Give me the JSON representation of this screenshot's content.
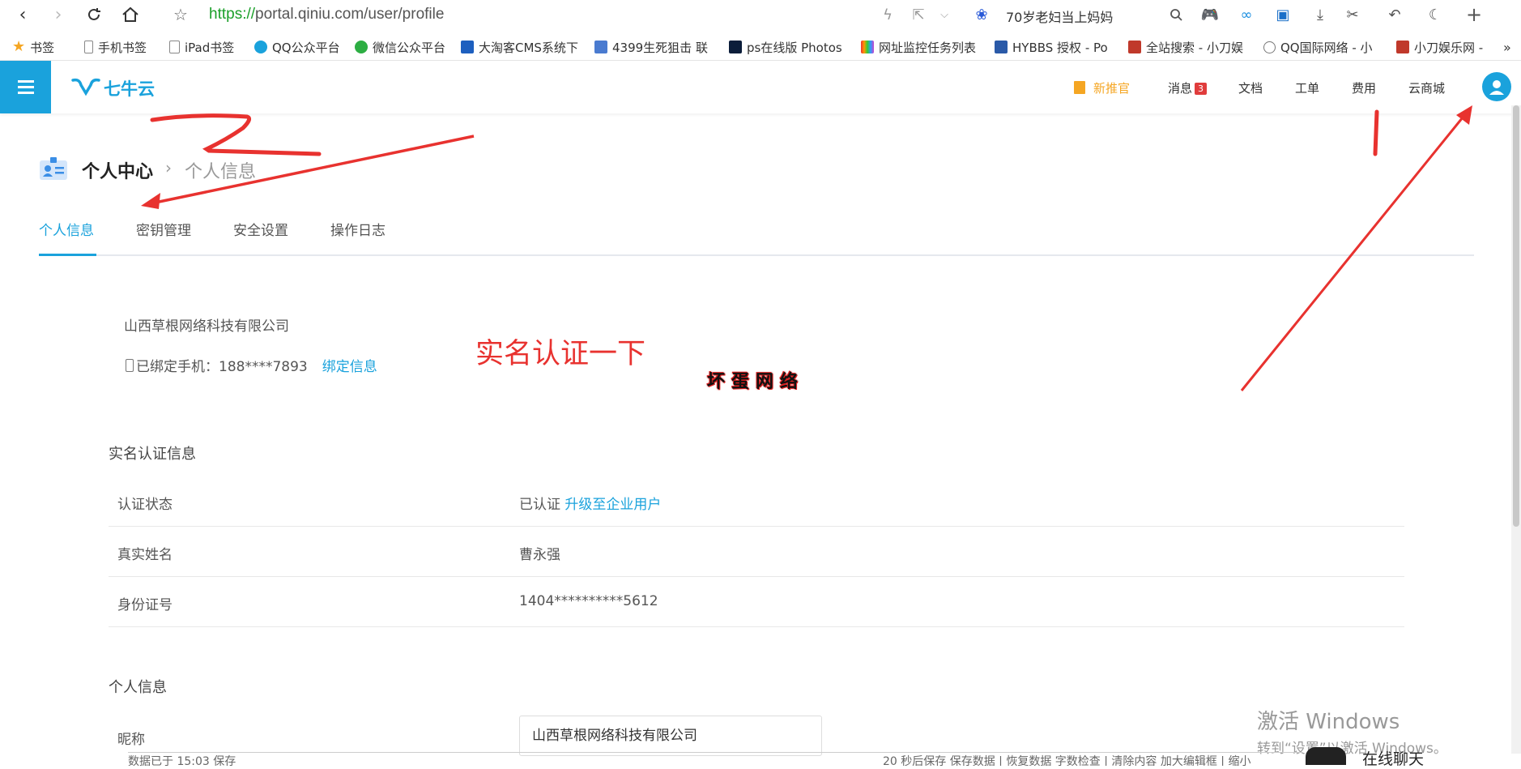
{
  "browser": {
    "url_protocol": "https://",
    "url_rest": "portal.qiniu.com/user/profile",
    "search_text": "70岁老妇当上妈妈",
    "bookmarks": [
      {
        "label": "书签",
        "icon": "star-icon",
        "color": "#f5a623"
      },
      {
        "label": "手机书签",
        "icon": "phone-icon",
        "color": "#888888"
      },
      {
        "label": "iPad书签",
        "icon": "tablet-icon",
        "color": "#888888"
      },
      {
        "label": "QQ公众平台",
        "icon": "qq-icon",
        "color": "#1aa2dc"
      },
      {
        "label": "微信公众平台",
        "icon": "wechat-icon",
        "color": "#2dae43"
      },
      {
        "label": "大淘客CMS系统下",
        "icon": "dataoke-icon",
        "color": "#1d5fbf"
      },
      {
        "label": "4399生死狙击 联",
        "icon": "grid-icon",
        "color": "#4a7bd0"
      },
      {
        "label": "ps在线版 Photos",
        "icon": "ps-icon",
        "color": "#0b1d3a"
      },
      {
        "label": "网址监控任务列表",
        "icon": "rainbow-icon",
        "color": "#c44ec4"
      },
      {
        "label": "HYBBS 授权 - Po",
        "icon": "hy-icon",
        "color": "#2a5aa8"
      },
      {
        "label": "全站搜索 - 小刀娱",
        "icon": "xiaodao-icon",
        "color": "#c0392b"
      },
      {
        "label": "QQ国际网络 - 小",
        "icon": "globe-icon",
        "color": "#777777"
      },
      {
        "label": "小刀娱乐网 -",
        "icon": "xiaodao-icon",
        "color": "#c0392b"
      }
    ]
  },
  "site": {
    "nav": {
      "new_recommend": "新推官",
      "messages": "消息",
      "messages_count": "3",
      "docs": "文档",
      "tickets": "工单",
      "billing": "费用",
      "cloud_mall": "云商城"
    }
  },
  "page": {
    "breadcrumb_main": "个人中心",
    "breadcrumb_sub": "个人信息",
    "tabs": [
      "个人信息",
      "密钥管理",
      "安全设置",
      "操作日志"
    ],
    "company_name": "山西草根网络科技有限公司",
    "phone_label": "已绑定手机：188****7893",
    "bind_link": "绑定信息",
    "realname_section_title": "实名认证信息",
    "realname_rows": [
      {
        "key": "认证状态",
        "value": "已认证",
        "link": "升级至企业用户"
      },
      {
        "key": "真实姓名",
        "value": "曹永强",
        "link": ""
      },
      {
        "key": "身份证号",
        "value": "1404**********5612",
        "link": ""
      }
    ],
    "personal_section_title": "个人信息",
    "nickname_label": "昵称",
    "nickname_value": "山西草根网络科技有限公司"
  },
  "annotations": {
    "note_text": "实名认证一下",
    "watermark": "坏蛋网络",
    "color": "#e8322f"
  },
  "windows": {
    "activate_title": "激活 Windows",
    "activate_sub": "转到“设置”以激活 Windows。"
  },
  "statusbar": {
    "left": "数据已于 15:03 保存",
    "right": "20 秒后保存 保存数据 | 恢复数据    字数检查 | 清除内容    加大编辑框 | 缩小"
  },
  "chat_label": "在线聊天"
}
